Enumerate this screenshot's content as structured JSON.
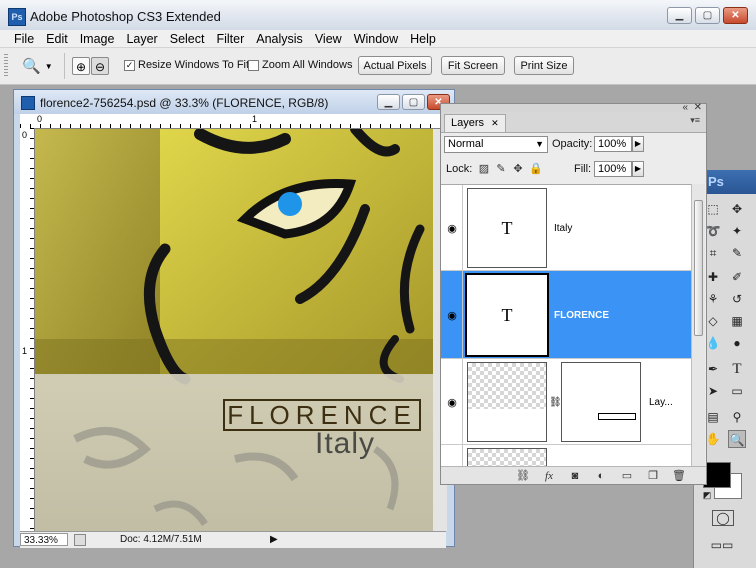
{
  "app": {
    "title": "Adobe Photoshop CS3 Extended",
    "icon_label": "Ps"
  },
  "menu": [
    "File",
    "Edit",
    "Image",
    "Layer",
    "Select",
    "Filter",
    "Analysis",
    "View",
    "Window",
    "Help"
  ],
  "options": {
    "tool_icon": "zoom-icon",
    "resize_windows": {
      "label": "Resize Windows To Fit",
      "checked": true
    },
    "zoom_all": {
      "label": "Zoom All Windows",
      "checked": false
    },
    "actual_pixels": "Actual Pixels",
    "fit_screen": "Fit Screen",
    "print_size": "Print Size"
  },
  "document": {
    "title": "florence2-756254.psd @ 33.3% (FLORENCE, RGB/8)",
    "ruler_h_labels": [
      "0",
      "1"
    ],
    "ruler_v_labels": [
      "0",
      "1"
    ],
    "zoom": "33.33%",
    "doc_info": "Doc: 4.12M/7.51M",
    "artwork": {
      "title": "FLORENCE",
      "subtitle": "Italy"
    }
  },
  "layers_panel": {
    "tab": "Layers",
    "blend_mode": "Normal",
    "opacity_label": "Opacity:",
    "opacity": "100%",
    "lock_label": "Lock:",
    "fill_label": "Fill:",
    "fill": "100%",
    "layers": [
      {
        "name": "Italy",
        "thumb": "T",
        "selected": false
      },
      {
        "name": "FLORENCE",
        "thumb": "T",
        "selected": true
      },
      {
        "name": "Lay...",
        "thumb": "",
        "selected": false
      }
    ]
  },
  "colors": {
    "selection": "#3a93f5",
    "title_gradient_top": "#f4f6f9",
    "close_button": "#c84a2c",
    "canvas_yellow": "#b8ac38"
  }
}
